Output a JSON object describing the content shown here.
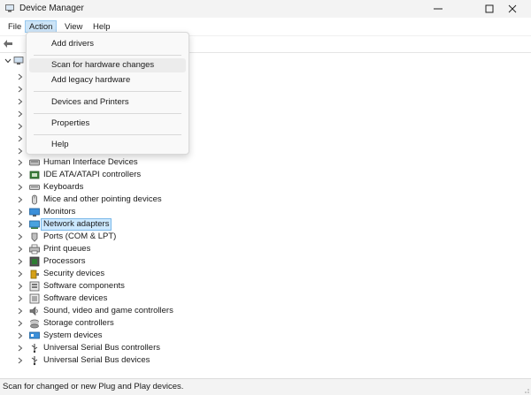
{
  "window": {
    "title": "Device Manager"
  },
  "menubar": {
    "items": [
      "File",
      "Action",
      "View",
      "Help"
    ]
  },
  "action_menu": {
    "items": [
      "Add drivers",
      "Scan for hardware changes",
      "Add legacy hardware",
      "Devices and Printers",
      "Properties",
      "Help"
    ]
  },
  "tree": {
    "nodes": [
      {
        "label": "Human Interface Devices",
        "icon": "hid-icon"
      },
      {
        "label": "IDE ATA/ATAPI controllers",
        "icon": "ide-controller-icon"
      },
      {
        "label": "Keyboards",
        "icon": "keyboard-icon"
      },
      {
        "label": "Mice and other pointing devices",
        "icon": "mouse-icon"
      },
      {
        "label": "Monitors",
        "icon": "monitor-icon"
      },
      {
        "label": "Network adapters",
        "icon": "network-adapter-icon"
      },
      {
        "label": "Ports (COM & LPT)",
        "icon": "port-icon"
      },
      {
        "label": "Print queues",
        "icon": "printer-icon"
      },
      {
        "label": "Processors",
        "icon": "processor-icon"
      },
      {
        "label": "Security devices",
        "icon": "security-icon"
      },
      {
        "label": "Software components",
        "icon": "software-component-icon"
      },
      {
        "label": "Software devices",
        "icon": "software-device-icon"
      },
      {
        "label": "Sound, video and game controllers",
        "icon": "sound-icon"
      },
      {
        "label": "Storage controllers",
        "icon": "storage-icon"
      },
      {
        "label": "System devices",
        "icon": "system-device-icon"
      },
      {
        "label": "Universal Serial Bus controllers",
        "icon": "usb-icon"
      },
      {
        "label": "Universal Serial Bus devices",
        "icon": "usb-icon"
      }
    ]
  },
  "status": {
    "text": "Scan for changed or new Plug and Play devices."
  }
}
